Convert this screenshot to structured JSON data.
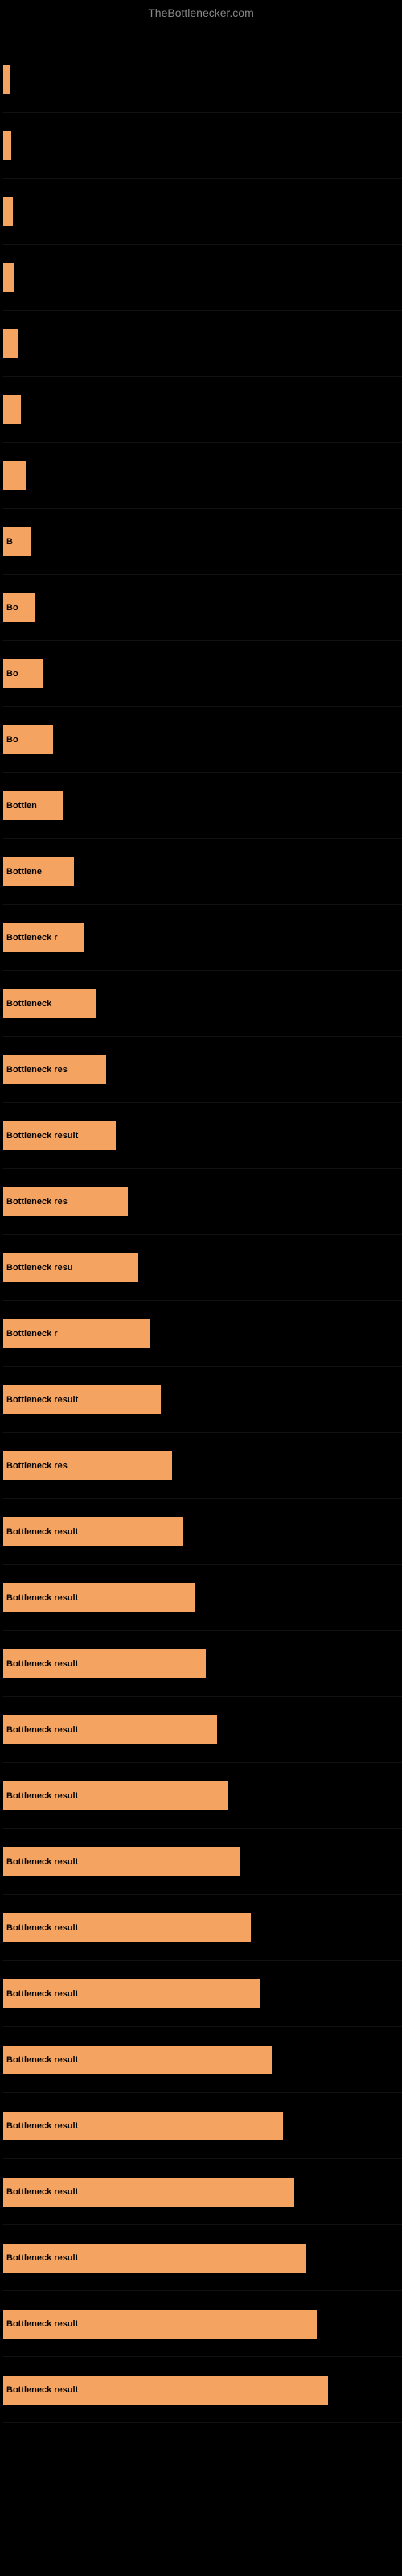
{
  "site": {
    "title": "TheBottlenecker.com"
  },
  "chart": {
    "bars": [
      {
        "id": 1,
        "label": "",
        "barClass": "bar-1"
      },
      {
        "id": 2,
        "label": "",
        "barClass": "bar-2"
      },
      {
        "id": 3,
        "label": "",
        "barClass": "bar-3"
      },
      {
        "id": 4,
        "label": "",
        "barClass": "bar-4"
      },
      {
        "id": 5,
        "label": "",
        "barClass": "bar-5"
      },
      {
        "id": 6,
        "label": "",
        "barClass": "bar-6"
      },
      {
        "id": 7,
        "label": "",
        "barClass": "bar-7"
      },
      {
        "id": 8,
        "label": "B",
        "barClass": "bar-8"
      },
      {
        "id": 9,
        "label": "Bo",
        "barClass": "bar-9"
      },
      {
        "id": 10,
        "label": "Bo",
        "barClass": "bar-10"
      },
      {
        "id": 11,
        "label": "Bo",
        "barClass": "bar-11"
      },
      {
        "id": 12,
        "label": "Bottlen",
        "barClass": "bar-12"
      },
      {
        "id": 13,
        "label": "Bottlene",
        "barClass": "bar-13"
      },
      {
        "id": 14,
        "label": "Bottleneck r",
        "barClass": "bar-14"
      },
      {
        "id": 15,
        "label": "Bottleneck",
        "barClass": "bar-15"
      },
      {
        "id": 16,
        "label": "Bottleneck res",
        "barClass": "bar-16"
      },
      {
        "id": 17,
        "label": "Bottleneck result",
        "barClass": "bar-17"
      },
      {
        "id": 18,
        "label": "Bottleneck res",
        "barClass": "bar-18"
      },
      {
        "id": 19,
        "label": "Bottleneck resu",
        "barClass": "bar-19"
      },
      {
        "id": 20,
        "label": "Bottleneck r",
        "barClass": "bar-20"
      },
      {
        "id": 21,
        "label": "Bottleneck result",
        "barClass": "bar-21"
      },
      {
        "id": 22,
        "label": "Bottleneck res",
        "barClass": "bar-22"
      },
      {
        "id": 23,
        "label": "Bottleneck result",
        "barClass": "bar-23"
      },
      {
        "id": 24,
        "label": "Bottleneck result",
        "barClass": "bar-24"
      },
      {
        "id": 25,
        "label": "Bottleneck result",
        "barClass": "bar-25"
      },
      {
        "id": 26,
        "label": "Bottleneck result",
        "barClass": "bar-26"
      },
      {
        "id": 27,
        "label": "Bottleneck result",
        "barClass": "bar-27"
      },
      {
        "id": 28,
        "label": "Bottleneck result",
        "barClass": "bar-28"
      },
      {
        "id": 29,
        "label": "Bottleneck result",
        "barClass": "bar-29"
      },
      {
        "id": 30,
        "label": "Bottleneck result",
        "barClass": "bar-30"
      },
      {
        "id": 31,
        "label": "Bottleneck result",
        "barClass": "bar-31"
      },
      {
        "id": 32,
        "label": "Bottleneck result",
        "barClass": "bar-32"
      },
      {
        "id": 33,
        "label": "Bottleneck result",
        "barClass": "bar-33"
      },
      {
        "id": 34,
        "label": "Bottleneck result",
        "barClass": "bar-34"
      },
      {
        "id": 35,
        "label": "Bottleneck result",
        "barClass": "bar-35"
      },
      {
        "id": 36,
        "label": "Bottleneck result",
        "barClass": "bar-36"
      }
    ]
  }
}
